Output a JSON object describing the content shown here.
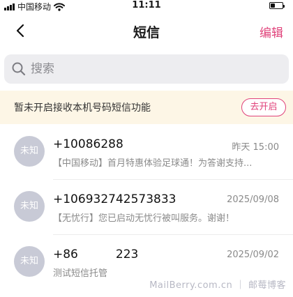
{
  "status_bar": {
    "carrier": "中国移动",
    "time": "11:11"
  },
  "nav": {
    "title": "短信",
    "edit_label": "编辑"
  },
  "search": {
    "placeholder": "搜索"
  },
  "notice": {
    "text": "暂未开启接收本机号码短信功能",
    "button_label": "去开启"
  },
  "messages": [
    {
      "avatar": "未知",
      "sender": "+10086288",
      "date": "昨天 15:00",
      "preview": "【中国移动】首月特惠体验足球通！为答谢支持..."
    },
    {
      "avatar": "未知",
      "sender": "+106932742573833",
      "date": "2025/09/08",
      "preview": "【无忧行】您已启动无忧行被叫服务。谢谢！"
    },
    {
      "avatar": "未知",
      "sender": "+86          223",
      "date": "2025/09/02",
      "preview": "测试短信托管"
    }
  ],
  "watermark": "MailBerry.com.cn ｜ 邮莓博客",
  "colors": {
    "accent": "#e0427a",
    "notice_bg": "#fdf6e6",
    "avatar_bg": "#c8cad6"
  }
}
